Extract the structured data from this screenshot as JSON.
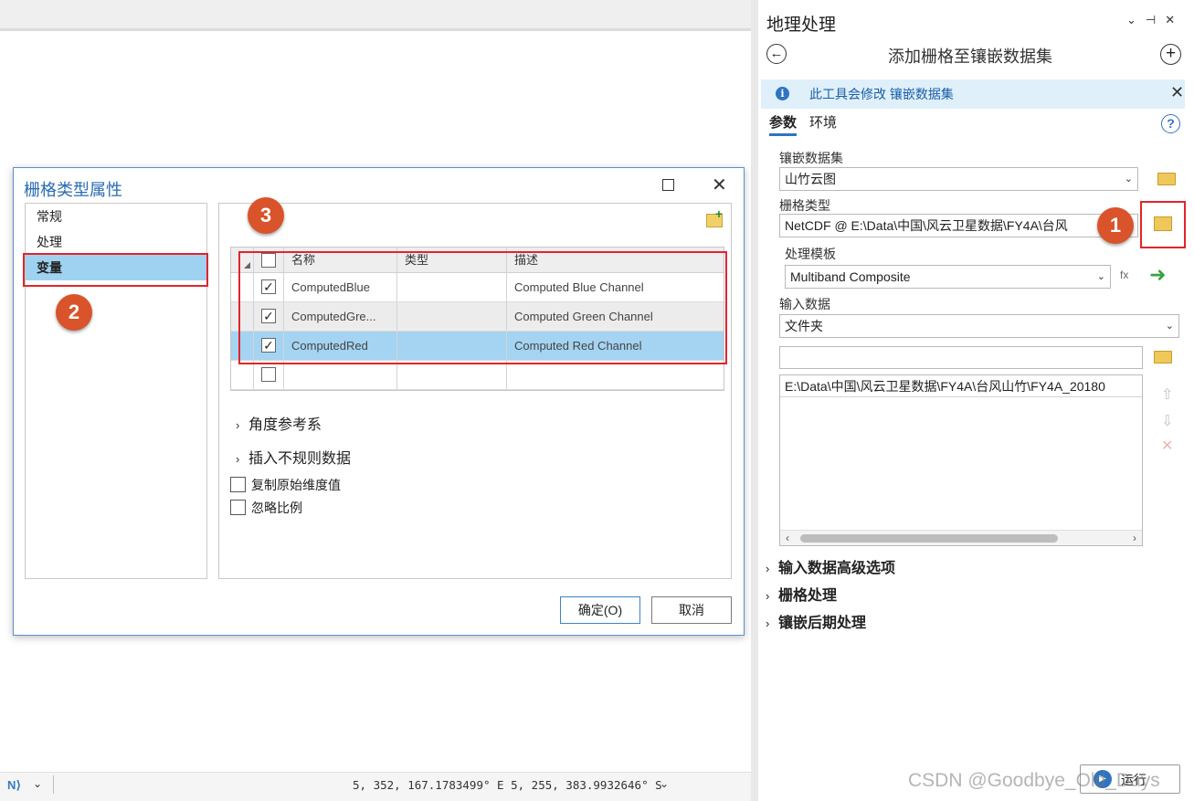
{
  "map": {
    "status_coords": "5, 352, 167.1783499° E 5, 255, 383.9932646° S"
  },
  "dialog": {
    "title": "栅格类型属性",
    "categories": [
      "常规",
      "处理",
      "变量"
    ],
    "selected_category": "变量",
    "table": {
      "headers": [
        "名称",
        "类型",
        "描述"
      ],
      "rows": [
        {
          "checked": true,
          "name": "ComputedBlue",
          "type": "",
          "desc": "Computed Blue Channel"
        },
        {
          "checked": true,
          "name": "ComputedGre...",
          "type": "",
          "desc": "Computed Green Channel"
        },
        {
          "checked": true,
          "name": "ComputedRed",
          "type": "",
          "desc": "Computed Red Channel"
        },
        {
          "checked": false,
          "name": "",
          "type": "",
          "desc": ""
        }
      ]
    },
    "expanders": [
      "角度参考系",
      "插入不规则数据"
    ],
    "options": [
      "复制原始维度值",
      "忽略比例"
    ],
    "ok_label": "确定(O)",
    "cancel_label": "取消"
  },
  "gp": {
    "title": "地理处理",
    "tool_title": "添加栅格至镶嵌数据集",
    "info_text": "此工具会修改 镶嵌数据集",
    "tabs": [
      "参数",
      "环境"
    ],
    "mosaic_label": "镶嵌数据集",
    "mosaic_value": "山竹云图",
    "raster_type_label": "栅格类型",
    "raster_type_value": "NetCDF @ E:\\Data\\中国\\风云卫星数据\\FY4A\\台风",
    "template_label": "处理模板",
    "template_value": "Multiband Composite",
    "input_label": "输入数据",
    "input_type_value": "文件夹",
    "input_path_value": "",
    "input_list": [
      "E:\\Data\\中国\\风云卫星数据\\FY4A\\台风山竹\\FY4A_20180"
    ],
    "sections": [
      "输入数据高级选项",
      "栅格处理",
      "镶嵌后期处理"
    ],
    "run_label": "运行"
  },
  "annotations": [
    "1",
    "2",
    "3"
  ],
  "watermark": "CSDN @Goodbye_Old_Days"
}
